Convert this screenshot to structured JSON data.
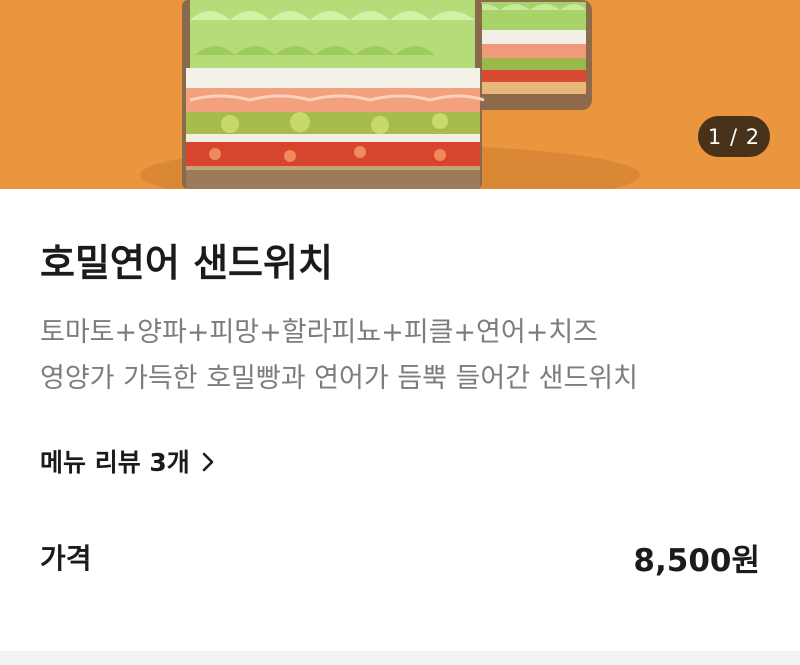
{
  "hero": {
    "image_alt": "호밀연어 샌드위치",
    "page_indicator": "1 / 2",
    "background_color": "#e9963f"
  },
  "product": {
    "name": "호밀연어 샌드위치",
    "description_lines": [
      "토마토+양파+피망+할라피뇨+피클+연어+치즈",
      "영양가 가득한 호밀빵과 연어가 듬뿍 들어간 샌드위치"
    ],
    "review_link": "메뉴 리뷰 3개",
    "price_label": "가격",
    "price_value": "8,500원"
  },
  "icons": {
    "review_chevron": "chevron-right-icon"
  }
}
